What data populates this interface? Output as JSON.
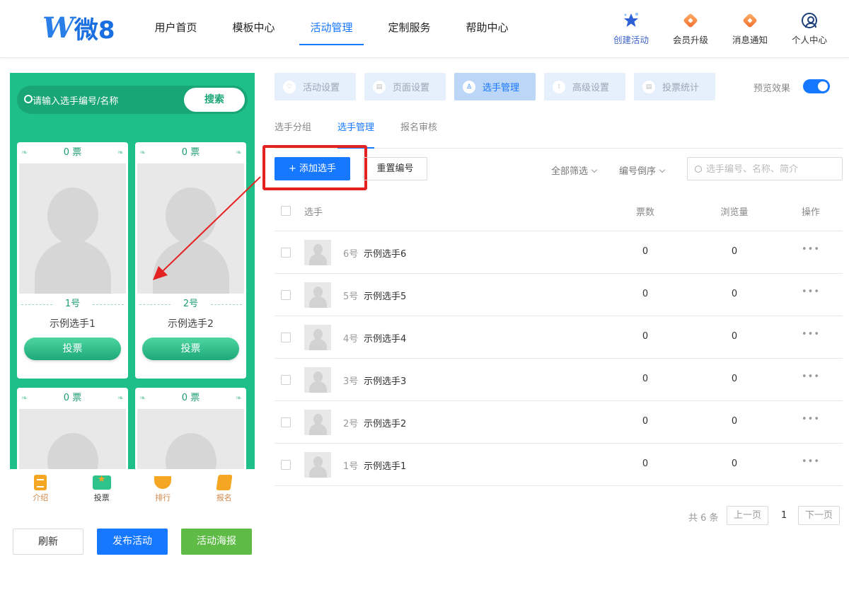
{
  "brand": {
    "logo_w": "W",
    "logo_text": "微8"
  },
  "nav": [
    "用户首页",
    "模板中心",
    "活动管理",
    "定制服务",
    "帮助中心"
  ],
  "header_actions": [
    "创建活动",
    "会员升级",
    "消息通知",
    "个人中心"
  ],
  "preview": {
    "search_placeholder": "请输入选手编号/名称",
    "search_button": "搜索",
    "cards": [
      {
        "votes": "0 票",
        "number": "1号",
        "name": "示例选手1",
        "button": "投票"
      },
      {
        "votes": "0 票",
        "number": "2号",
        "name": "示例选手2",
        "button": "投票"
      },
      {
        "votes": "0 票"
      },
      {
        "votes": "0 票"
      }
    ],
    "tabbar": [
      "介绍",
      "投票",
      "排行",
      "报名"
    ]
  },
  "bottom_buttons": [
    "刷新",
    "发布活动",
    "活动海报"
  ],
  "steps": [
    "活动设置",
    "页面设置",
    "选手管理",
    "高级设置",
    "投票统计"
  ],
  "preview_toggle_label": "预览效果",
  "subtabs": [
    "选手分组",
    "选手管理",
    "报名审核"
  ],
  "toolbar": {
    "add_label": "+ 添加选手",
    "reset_label": "重置编号",
    "filter_all": "全部筛选",
    "sort_label": "编号倒序",
    "search_placeholder": "选手编号、名称、简介"
  },
  "table": {
    "headers": {
      "player": "选手",
      "votes": "票数",
      "views": "浏览量",
      "ops": "操作"
    },
    "rows": [
      {
        "no": "6号",
        "name": "示例选手6",
        "votes": "0",
        "views": "0",
        "ops": "•••"
      },
      {
        "no": "5号",
        "name": "示例选手5",
        "votes": "0",
        "views": "0",
        "ops": "•••"
      },
      {
        "no": "4号",
        "name": "示例选手4",
        "votes": "0",
        "views": "0",
        "ops": "•••"
      },
      {
        "no": "3号",
        "name": "示例选手3",
        "votes": "0",
        "views": "0",
        "ops": "•••"
      },
      {
        "no": "2号",
        "name": "示例选手2",
        "votes": "0",
        "views": "0",
        "ops": "•••"
      },
      {
        "no": "1号",
        "name": "示例选手1",
        "votes": "0",
        "views": "0",
        "ops": "•••"
      }
    ]
  },
  "pagination": {
    "total": "共 6 条",
    "prev": "上一页",
    "current": "1",
    "next": "下一页"
  },
  "colors": {
    "primary": "#1677ff",
    "preview_green": "#1fbf89",
    "highlight_red": "#e52222",
    "poster_green": "#5dbb46"
  },
  "icons": [
    "search-icon",
    "star-create-icon",
    "diamond-icon",
    "bell-diamond-icon",
    "user-circle-icon",
    "toggle-icon",
    "ellipsis-icon"
  ]
}
